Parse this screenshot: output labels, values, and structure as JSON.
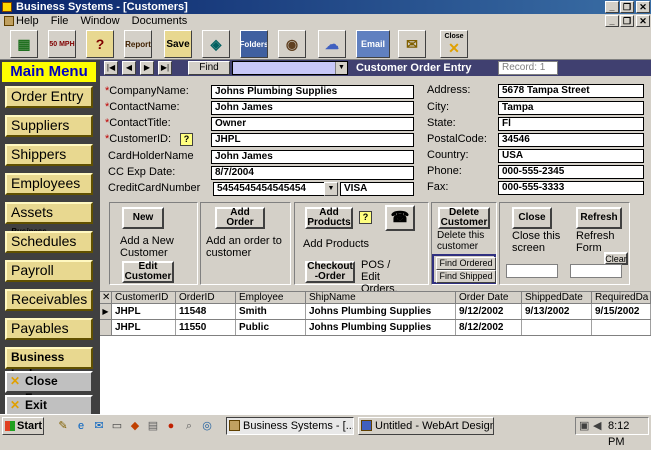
{
  "window": {
    "title": "Business Systems - [Customers]",
    "controls": [
      "_",
      "❐",
      "✕"
    ],
    "doc_controls": [
      "_",
      "❐",
      "✕"
    ]
  },
  "menubar": [
    "Help",
    "File",
    "Window",
    "Documents"
  ],
  "toolbar": [
    {
      "icon": "map-icon",
      "label": ""
    },
    {
      "icon": "speed-icon",
      "label": "50 MPH"
    },
    {
      "icon": "help-icon",
      "label": "?"
    },
    {
      "icon": "report-icon",
      "label": "Report"
    },
    {
      "icon": "save-icon",
      "label": "Save"
    },
    {
      "icon": "camera-icon",
      "label": ""
    },
    {
      "icon": "folder-icon",
      "label": "Folders"
    },
    {
      "icon": "disc-icon",
      "label": ""
    },
    {
      "icon": "cloud-icon",
      "label": ""
    },
    {
      "icon": "email-icon",
      "label": "Email"
    },
    {
      "icon": "notes-icon",
      "label": ""
    },
    {
      "icon": "close-icon",
      "label": "Close"
    }
  ],
  "main_menu": {
    "title": "Main Menu",
    "items": [
      "Order Entry",
      "Suppliers",
      "Shippers",
      "Employees",
      "Assets",
      "Schedules",
      "Payroll",
      "Receivables",
      "Payables",
      "Business Ledger",
      "Close Forms",
      "Exit Program"
    ],
    "assets_tag": "Business"
  },
  "nav": {
    "buttons": [
      "|◀",
      "◀",
      "▶",
      "▶|"
    ],
    "find_label": "Find",
    "find_value": "",
    "form_title": "Customer Order Entry",
    "record": "Record: 1"
  },
  "fields": {
    "company_label": "CompanyName:",
    "company_value": "Johns Plumbing Supplies",
    "contact_label": "ContactName:",
    "contact_value": "John James",
    "title_label": "ContactTitle:",
    "title_value": "Owner",
    "id_label": "CustomerID:",
    "id_value": "JHPL",
    "cardholder_label": "CardHolderName",
    "cardholder_value": "John James",
    "exp_label": "CC Exp Date:",
    "exp_value": "8/7/2004",
    "ccnum_label": "CreditCardNumber",
    "ccnum_value": "5454545454545454",
    "cctype_value": "VISA",
    "address_label": "Address:",
    "address_value": "5678 Tampa Street",
    "city_label": "City:",
    "city_value": "Tampa",
    "state_label": "State:",
    "state_value": "Fl",
    "postal_label": "PostalCode:",
    "postal_value": "34546",
    "country_label": "Country:",
    "country_value": "USA",
    "phone_label": "Phone:",
    "phone_value": "000-555-2345",
    "fax_label": "Fax:",
    "fax_value": "000-555-3333"
  },
  "actions": {
    "new_label": "New",
    "new_desc": "Add a New Customer",
    "edit_label": "Edit Customer",
    "add_order_label": "Add Order",
    "add_order_desc": "Add an order to customer",
    "add_products_label": "Add Products",
    "add_products_desc": "Add Products",
    "checkout_label": "Checkout -Order",
    "checkout_desc": "POS / Edit Orders.",
    "delete_label": "Delete Customer",
    "delete_desc": "Delete this customer",
    "find_ordered_label": "Find Ordered",
    "find_shipped_label": "Find Shipped",
    "close_label": "Close",
    "close_desc": "Close this screen",
    "refresh_label": "Refresh",
    "refresh_desc": "Refresh Form",
    "clear_label": "Clear"
  },
  "grid": {
    "columns": [
      "CustomerID",
      "OrderID",
      "Employee",
      "ShipName",
      "Order Date",
      "ShippedDate",
      "RequiredDa"
    ],
    "rows": [
      [
        "JHPL",
        "11548",
        "Smith",
        "Johns Plumbing Supplies",
        "9/12/2002",
        "9/13/2002",
        "9/15/2002"
      ],
      [
        "JHPL",
        "11550",
        "Public",
        "Johns Plumbing Supplies",
        "8/12/2002",
        "",
        ""
      ]
    ]
  },
  "taskbar": {
    "start": "Start",
    "tasks": [
      "Business Systems - [...",
      "Untitled - WebArt Designer"
    ],
    "time": "8:12 PM"
  }
}
